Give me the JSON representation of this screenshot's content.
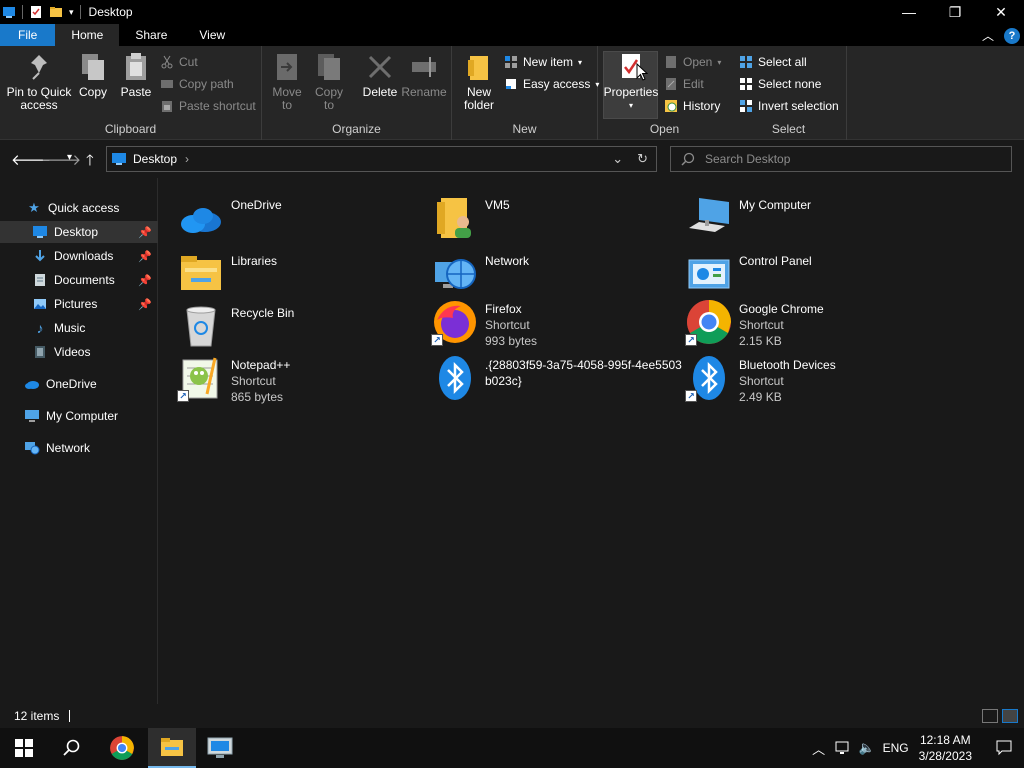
{
  "window": {
    "title": "Desktop"
  },
  "tabs": [
    {
      "label": "File"
    },
    {
      "label": "Home"
    },
    {
      "label": "Share"
    },
    {
      "label": "View"
    }
  ],
  "ribbon": {
    "clipboard": {
      "label": "Clipboard",
      "pin": [
        "Pin to Quick",
        "access"
      ],
      "copy": "Copy",
      "paste": "Paste",
      "cut": "Cut",
      "copy_path": "Copy path",
      "paste_shortcut": "Paste shortcut"
    },
    "organize": {
      "label": "Organize",
      "move_to": [
        "Move",
        "to"
      ],
      "copy_to": [
        "Copy",
        "to"
      ],
      "delete": "Delete",
      "rename": "Rename"
    },
    "new": {
      "label": "New",
      "new_folder": [
        "New",
        "folder"
      ],
      "new_item": "New item",
      "easy_access": "Easy access"
    },
    "open": {
      "label": "Open",
      "properties": "Properties",
      "open": "Open",
      "edit": "Edit",
      "history": "History"
    },
    "select": {
      "label": "Select",
      "select_all": "Select all",
      "select_none": "Select none",
      "invert": "Invert selection"
    }
  },
  "address": {
    "crumb": "Desktop",
    "search_placeholder": "Search Desktop"
  },
  "sidebar": {
    "items": [
      {
        "label": "Quick access"
      },
      {
        "label": "Desktop"
      },
      {
        "label": "Downloads"
      },
      {
        "label": "Documents"
      },
      {
        "label": "Pictures"
      },
      {
        "label": "Music"
      },
      {
        "label": "Videos"
      },
      {
        "label": "OneDrive"
      },
      {
        "label": "My Computer"
      },
      {
        "label": "Network"
      }
    ]
  },
  "files": [
    {
      "name": "OneDrive",
      "sub1": "",
      "sub2": ""
    },
    {
      "name": "VM5",
      "sub1": "",
      "sub2": ""
    },
    {
      "name": "My Computer",
      "sub1": "",
      "sub2": ""
    },
    {
      "name": "Libraries",
      "sub1": "",
      "sub2": ""
    },
    {
      "name": "Network",
      "sub1": "",
      "sub2": ""
    },
    {
      "name": "Control Panel",
      "sub1": "",
      "sub2": ""
    },
    {
      "name": "Recycle Bin",
      "sub1": "",
      "sub2": ""
    },
    {
      "name": "Firefox",
      "sub1": "Shortcut",
      "sub2": "993 bytes"
    },
    {
      "name": "Google Chrome",
      "sub1": "Shortcut",
      "sub2": "2.15 KB"
    },
    {
      "name": "Notepad++",
      "sub1": "Shortcut",
      "sub2": "865 bytes"
    },
    {
      "name": ".{28803f59-3a75-4058-995f-4ee5503",
      "sub1": "b023c}",
      "sub2": ""
    },
    {
      "name": "Bluetooth Devices",
      "sub1": "Shortcut",
      "sub2": "2.49 KB"
    }
  ],
  "status": {
    "items": "12 items"
  },
  "taskbar": {
    "lang": "ENG",
    "time": "12:18 AM",
    "date": "3/28/2023"
  },
  "colors": {
    "accent": "#1979ca",
    "background": "#191919",
    "ribbon": "#262626"
  }
}
